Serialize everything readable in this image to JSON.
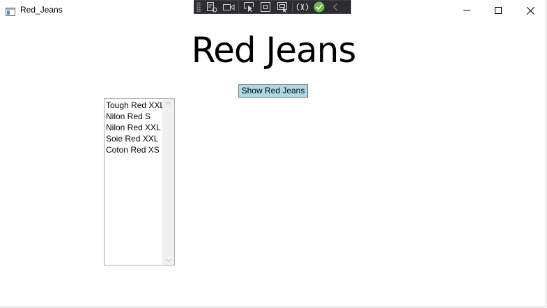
{
  "window": {
    "title": "Red_Jeans"
  },
  "debug_toolbar": {
    "icons": [
      "go-to-live-visual-tree-icon",
      "record-icon",
      "select-element-icon",
      "display-layout-adorners-icon",
      "track-focused-element-icon",
      "hot-reload-icon",
      "binding-success-icon",
      "collapse-icon"
    ]
  },
  "main": {
    "heading": "Red Jeans",
    "show_button_label": "Show Red Jeans",
    "list_items": [
      "Tough Red XXL",
      "Nilon Red S",
      "Nilon Red XXL",
      "Soie Red XXL",
      "Coton Red XS"
    ]
  },
  "colors": {
    "button_bg": "#add8e6",
    "toolbar_bg": "#2d2d30",
    "check_green": "#6abf4b"
  }
}
